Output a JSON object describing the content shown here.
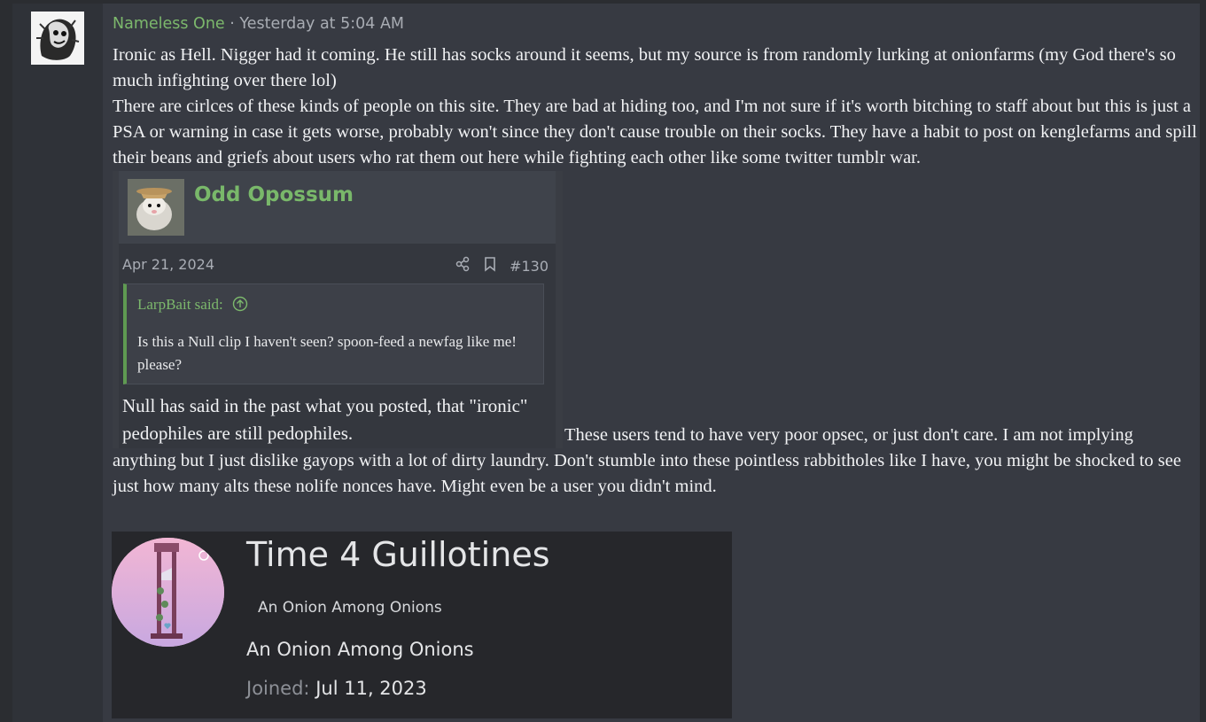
{
  "post": {
    "username": "Nameless One",
    "separator": "·",
    "timestamp": "Yesterday at 5:04 AM",
    "paragraph1": "Ironic as Hell. Nigger had it coming. He still has socks around it seems, but my source is from randomly lurking at onionfarms (my God there's so much infighting over there lol)",
    "paragraph2": "There are cirlces of these kinds of people on this site. They are bad at hiding too, and I'm not sure if it's worth bitching to staff about but this is just a PSA or warning in case it gets worse, probably won't since they don't cause trouble on their socks. They have a habit to post on kenglefarms and spill their beans and griefs about users who rat them out here while fighting each other like some twitter tumblr war.",
    "paragraph3": "These users tend to have very poor opsec, or just don't care. I am not implying anything but I just dislike gayops with a lot of dirty laundry. Don't stumble into these pointless rabbitholes like I have, you might be shocked to see just how many alts these nolife nonces have. Might even be a user you didn't mind."
  },
  "screenshot1": {
    "username": "Odd Opossum",
    "date": "Apr 21, 2024",
    "post_number": "#130",
    "share_icon": "share-icon",
    "bookmark_icon": "bookmark-icon",
    "quote_author": "LarpBait said:",
    "quote_text": "Is this a Null clip I haven't seen? spoon-feed a newfag like me! please?",
    "reply_text": "Null has said in the past what you posted, that \"ironic\" pedophiles are still pedophiles."
  },
  "screenshot2": {
    "username": "Time 4 Guillotines",
    "title_small": "An Onion Among Onions",
    "title_large": "An Onion Among Onions",
    "joined_label": "Joined:",
    "joined_value": "Jul 11, 2023"
  },
  "colors": {
    "background": "#2b2d31",
    "post_bg": "#373a42",
    "username": "#7cb86c",
    "text": "#f1f2f4"
  }
}
